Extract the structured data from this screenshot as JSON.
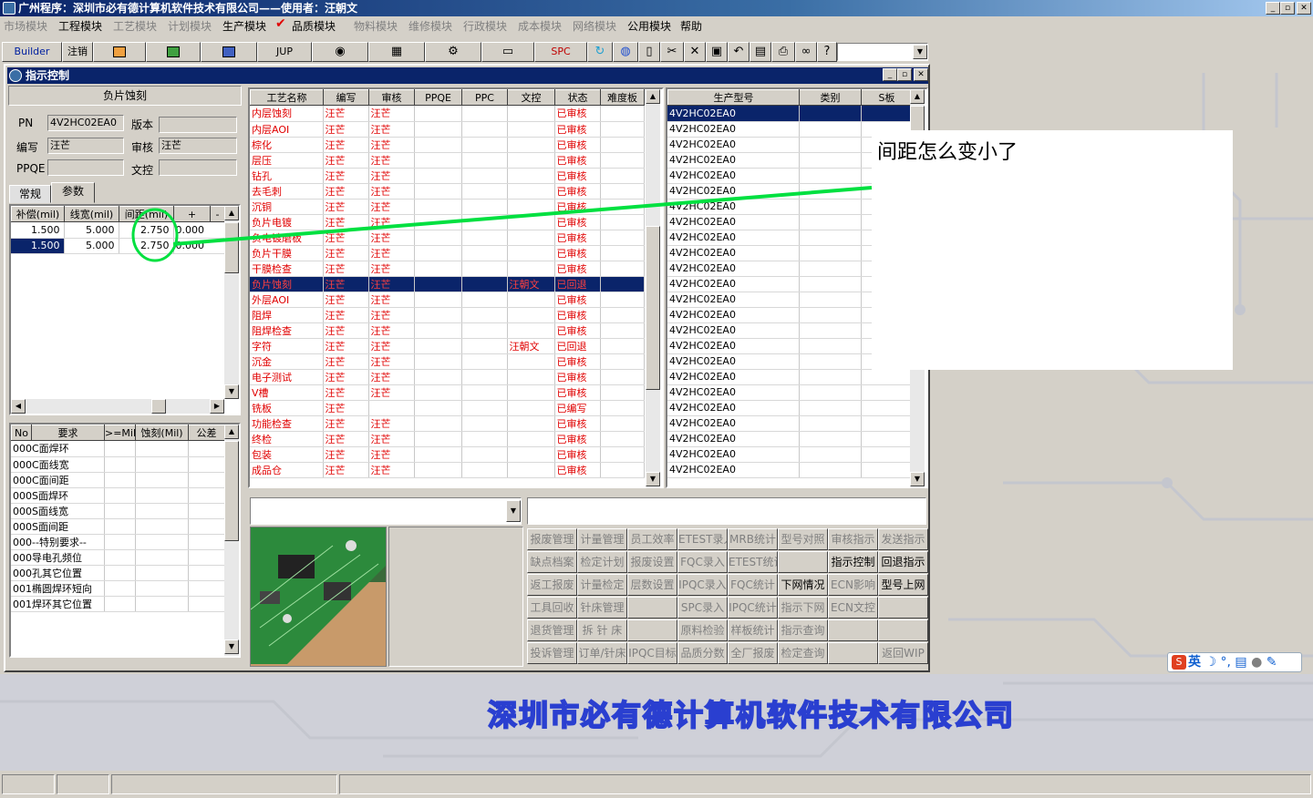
{
  "app": {
    "title": "广州程序：深圳市必有德计算机软件技术有限公司——使用者：汪朝文",
    "min": "_",
    "max": "▫",
    "close": "✕"
  },
  "menu": [
    {
      "label": "市场模块",
      "enabled": false
    },
    {
      "label": "工程模块",
      "enabled": true
    },
    {
      "label": "工艺模块",
      "enabled": false
    },
    {
      "label": "计划模块",
      "enabled": false
    },
    {
      "label": "生产模块",
      "enabled": true
    },
    {
      "label": "品质模块",
      "enabled": true
    },
    {
      "label": "物料模块",
      "enabled": false
    },
    {
      "label": "维修模块",
      "enabled": false
    },
    {
      "label": "行政模块",
      "enabled": false
    },
    {
      "label": "成本模块",
      "enabled": false
    },
    {
      "label": "网络模块",
      "enabled": false
    },
    {
      "label": "公用模块",
      "enabled": true
    },
    {
      "label": "帮助",
      "enabled": true
    }
  ],
  "menu_check": "✔",
  "toolbar": {
    "builder": "Builder",
    "logout": "注销",
    "jup": "JUP",
    "spc": "SPC"
  },
  "window": {
    "title": "指示控制"
  },
  "left": {
    "header": "负片蚀刻",
    "pn_label": "PN",
    "pn_value": "4V2HC02EA0",
    "version_label": "版本",
    "version_value": "",
    "writer_label": "编写",
    "writer_value": "汪芒",
    "reviewer_label": "审核",
    "reviewer_value": "汪芒",
    "ppqe_label": "PPQE",
    "ppqe_value": "",
    "doc_label": "文控",
    "doc_value": "",
    "tabs": [
      "常规",
      "参数"
    ],
    "param_columns": [
      "补偿(mil)",
      "线宽(mil)",
      "间距(mil)",
      "+",
      "-"
    ],
    "param_rows": [
      {
        "comp": "1.500",
        "width": "5.000",
        "gap": "2.750",
        "plus": "0.000",
        "selected": false
      },
      {
        "comp": "1.500",
        "width": "5.000",
        "gap": "2.750",
        "plus": "0.000",
        "selected": true
      }
    ],
    "req_columns": [
      "No",
      "要求",
      ">=Mil",
      "蚀刻(Mil)",
      "公差"
    ],
    "req_rows": [
      {
        "no": "000",
        "req": "C面焊环"
      },
      {
        "no": "000",
        "req": "C面线宽"
      },
      {
        "no": "000",
        "req": "C面间距"
      },
      {
        "no": "000",
        "req": "S面焊环"
      },
      {
        "no": "000",
        "req": "S面线宽"
      },
      {
        "no": "000",
        "req": "S面间距"
      },
      {
        "no": "000",
        "req": "--特别要求--"
      },
      {
        "no": "000",
        "req": "导电孔频位"
      },
      {
        "no": "000",
        "req": "孔其它位置"
      },
      {
        "no": "001",
        "req": "椭圆焊环短向"
      },
      {
        "no": "001",
        "req": "焊环其它位置"
      }
    ]
  },
  "process": {
    "columns": [
      "工艺名称",
      "编写",
      "审核",
      "PPQE",
      "PPC",
      "文控",
      "状态",
      "难度板"
    ],
    "rows": [
      {
        "name": "内层蚀刻",
        "writer": "汪芒",
        "reviewer": "汪芒",
        "doc": "",
        "status": "已审核"
      },
      {
        "name": "内层AOI",
        "writer": "汪芒",
        "reviewer": "汪芒",
        "doc": "",
        "status": "已审核"
      },
      {
        "name": "棕化",
        "writer": "汪芒",
        "reviewer": "汪芒",
        "doc": "",
        "status": "已审核"
      },
      {
        "name": "层压",
        "writer": "汪芒",
        "reviewer": "汪芒",
        "doc": "",
        "status": "已审核"
      },
      {
        "name": "钻孔",
        "writer": "汪芒",
        "reviewer": "汪芒",
        "doc": "",
        "status": "已审核"
      },
      {
        "name": "去毛刺",
        "writer": "汪芒",
        "reviewer": "汪芒",
        "doc": "",
        "status": "已审核"
      },
      {
        "name": "沉铜",
        "writer": "汪芒",
        "reviewer": "汪芒",
        "doc": "",
        "status": "已审核"
      },
      {
        "name": "负片电镀",
        "writer": "汪芒",
        "reviewer": "汪芒",
        "doc": "",
        "status": "已审核"
      },
      {
        "name": "负电镀磨板",
        "writer": "汪芒",
        "reviewer": "汪芒",
        "doc": "",
        "status": "已审核"
      },
      {
        "name": "负片干膜",
        "writer": "汪芒",
        "reviewer": "汪芒",
        "doc": "",
        "status": "已审核"
      },
      {
        "name": "干膜检查",
        "writer": "汪芒",
        "reviewer": "汪芒",
        "doc": "",
        "status": "已审核"
      },
      {
        "name": "负片蚀刻",
        "writer": "汪芒",
        "reviewer": "汪芒",
        "doc": "汪朝文",
        "status": "已回退",
        "selected": true
      },
      {
        "name": "外层AOI",
        "writer": "汪芒",
        "reviewer": "汪芒",
        "doc": "",
        "status": "已审核"
      },
      {
        "name": "阻焊",
        "writer": "汪芒",
        "reviewer": "汪芒",
        "doc": "",
        "status": "已审核"
      },
      {
        "name": "阻焊检查",
        "writer": "汪芒",
        "reviewer": "汪芒",
        "doc": "",
        "status": "已审核"
      },
      {
        "name": "字符",
        "writer": "汪芒",
        "reviewer": "汪芒",
        "doc": "汪朝文",
        "status": "已回退"
      },
      {
        "name": "沉金",
        "writer": "汪芒",
        "reviewer": "汪芒",
        "doc": "",
        "status": "已审核"
      },
      {
        "name": "电子测试",
        "writer": "汪芒",
        "reviewer": "汪芒",
        "doc": "",
        "status": "已审核"
      },
      {
        "name": "V槽",
        "writer": "汪芒",
        "reviewer": "汪芒",
        "doc": "",
        "status": "已审核"
      },
      {
        "name": "铣板",
        "writer": "汪芒",
        "reviewer": "",
        "doc": "",
        "status": "已编写"
      },
      {
        "name": "功能检查",
        "writer": "汪芒",
        "reviewer": "汪芒",
        "doc": "",
        "status": "已审核"
      },
      {
        "name": "终检",
        "writer": "汪芒",
        "reviewer": "汪芒",
        "doc": "",
        "status": "已审核"
      },
      {
        "name": "包装",
        "writer": "汪芒",
        "reviewer": "汪芒",
        "doc": "",
        "status": "已审核"
      },
      {
        "name": "成品仓",
        "writer": "汪芒",
        "reviewer": "汪芒",
        "doc": "",
        "status": "已审核"
      }
    ]
  },
  "models": {
    "columns": [
      "生产型号",
      "类别",
      "S板"
    ],
    "rows": [
      "4V2HC02EA0",
      "4V2HC02EA0",
      "4V2HC02EA0",
      "4V2HC02EA0",
      "4V2HC02EA0",
      "4V2HC02EA0",
      "4V2HC02EA0",
      "4V2HC02EA0",
      "4V2HC02EA0",
      "4V2HC02EA0",
      "4V2HC02EA0",
      "4V2HC02EA0",
      "4V2HC02EA0",
      "4V2HC02EA0",
      "4V2HC02EA0",
      "4V2HC02EA0",
      "4V2HC02EA0",
      "4V2HC02EA0",
      "4V2HC02EA0",
      "4V2HC02EA0",
      "4V2HC02EA0",
      "4V2HC02EA0",
      "4V2HC02EA0",
      "4V2HC02EA0"
    ]
  },
  "buttons": [
    [
      {
        "l": "报废管理",
        "e": false
      },
      {
        "l": "计量管理",
        "e": false
      },
      {
        "l": "员工效率",
        "e": false
      },
      {
        "l": "ETEST录入",
        "e": false
      },
      {
        "l": "MRB统计",
        "e": false
      },
      {
        "l": "型号对照",
        "e": false
      },
      {
        "l": "审核指示",
        "e": false
      },
      {
        "l": "发送指示",
        "e": false
      }
    ],
    [
      {
        "l": "缺点档案",
        "e": false
      },
      {
        "l": "检定计划",
        "e": false
      },
      {
        "l": "报废设置",
        "e": false
      },
      {
        "l": "FQC录入",
        "e": false
      },
      {
        "l": "ETEST统计",
        "e": false
      },
      {
        "l": "",
        "e": false
      },
      {
        "l": "指示控制",
        "e": true
      },
      {
        "l": "回退指示",
        "e": true
      }
    ],
    [
      {
        "l": "返工报废",
        "e": false
      },
      {
        "l": "计量检定",
        "e": false
      },
      {
        "l": "层数设置",
        "e": false
      },
      {
        "l": "IPQC录入",
        "e": false
      },
      {
        "l": "FQC统计",
        "e": false
      },
      {
        "l": "下网情况",
        "e": true
      },
      {
        "l": "ECN影响",
        "e": false
      },
      {
        "l": "型号上网",
        "e": true
      }
    ],
    [
      {
        "l": "工具回收",
        "e": false
      },
      {
        "l": "针床管理",
        "e": false
      },
      {
        "l": "",
        "e": false
      },
      {
        "l": "SPC录入",
        "e": false
      },
      {
        "l": "IPQC统计",
        "e": false
      },
      {
        "l": "指示下网",
        "e": false
      },
      {
        "l": "ECN文控",
        "e": false
      },
      {
        "l": "",
        "e": false
      }
    ],
    [
      {
        "l": "退货管理",
        "e": false
      },
      {
        "l": "拆 针 床",
        "e": false
      },
      {
        "l": "",
        "e": false
      },
      {
        "l": "原料检验",
        "e": false
      },
      {
        "l": "样板统计",
        "e": false
      },
      {
        "l": "指示查询",
        "e": false
      },
      {
        "l": "",
        "e": false
      },
      {
        "l": "",
        "e": false
      }
    ],
    [
      {
        "l": "投诉管理",
        "e": false
      },
      {
        "l": "订单/针床",
        "e": false
      },
      {
        "l": "IPQC目标",
        "e": false
      },
      {
        "l": "品质分数",
        "e": false
      },
      {
        "l": "全厂报废",
        "e": false
      },
      {
        "l": "检定查询",
        "e": false
      },
      {
        "l": "",
        "e": false
      },
      {
        "l": "返回WIP",
        "e": false
      }
    ]
  ],
  "annotation": {
    "text": "间距怎么变小了"
  },
  "brand": {
    "text": "深圳市必有德计算机软件技术有限公司"
  },
  "ime": {
    "label": "英"
  },
  "colors": {
    "accent": "#0a246a",
    "highlight": "#00e040",
    "red": "#e00000"
  }
}
